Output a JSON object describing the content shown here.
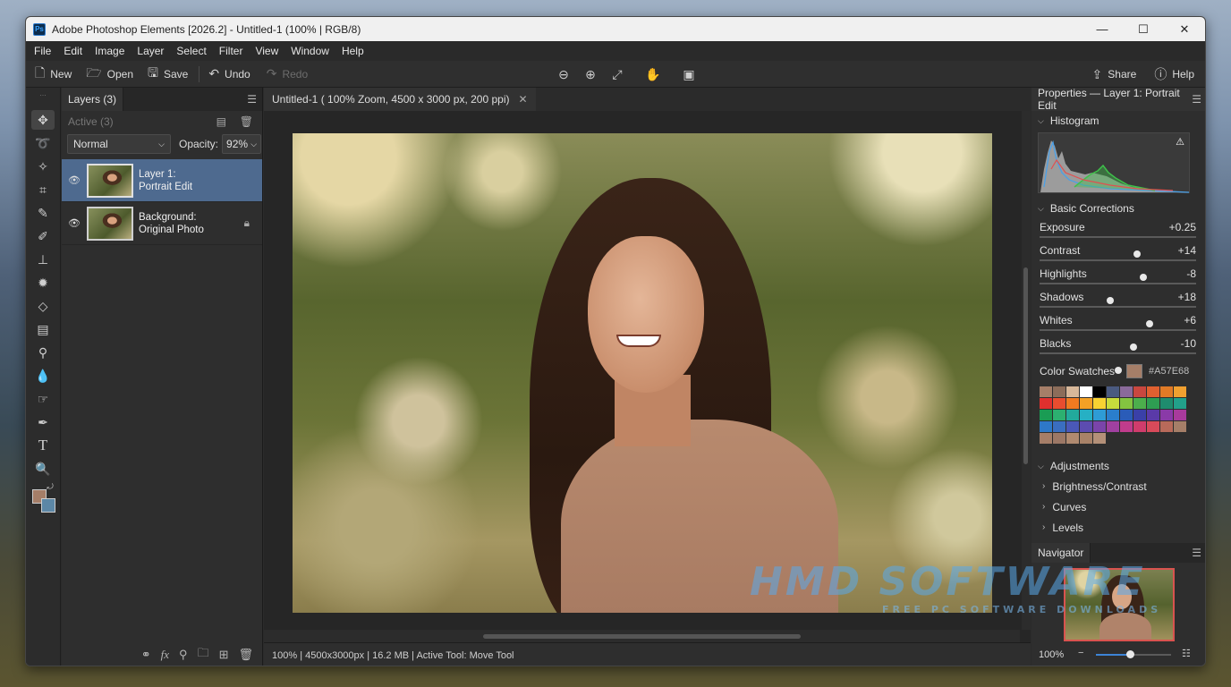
{
  "window": {
    "title": "Adobe Photoshop Elements [2026.2] - Untitled-1 (100% | RGB/8)",
    "app_icon": "Ps"
  },
  "menu": [
    "File",
    "Edit",
    "Image",
    "Layer",
    "Select",
    "Filter",
    "View",
    "Window",
    "Help"
  ],
  "toolbar": {
    "new": "New",
    "open": "Open",
    "save": "Save",
    "undo": "Undo",
    "redo": "Redo",
    "share": "Share",
    "help": "Help"
  },
  "layers": {
    "tab": "Layers (3)",
    "active_label": "Active (3)",
    "blend_mode": "Normal",
    "opacity_label": "Opacity:",
    "opacity_value": "92%",
    "items": [
      {
        "line1": "Layer 1:",
        "line2": "Portrait Edit"
      },
      {
        "line1": "Background:",
        "line2": "Original Photo"
      }
    ]
  },
  "document": {
    "tab": "Untitled-1 ( 100% Zoom, 4500 x 3000 px, 200 ppi)",
    "status": "100% | 4500x3000px | 16.2 MB | Active Tool: Move Tool"
  },
  "properties": {
    "tab": "Properties — Layer 1: Portrait Edit",
    "histogram_label": "Histogram",
    "basic_label": "Basic Corrections",
    "sliders": [
      {
        "label": "Exposure",
        "value": "+0.25",
        "level": 0.62
      },
      {
        "label": "Contrast",
        "value": "+14",
        "level": 0.66
      },
      {
        "label": "Highlights",
        "value": "-8",
        "level": 0.45
      },
      {
        "label": "Shadows",
        "value": "+18",
        "level": 0.7
      },
      {
        "label": "Whites",
        "value": "+6",
        "level": 0.6
      },
      {
        "label": "Blacks",
        "value": "-10",
        "level": 0.5
      }
    ],
    "swatches_label": "Color Swatches",
    "current_swatch": "#A57E68",
    "swatch_colors": [
      "#a57e68",
      "#8c6d5a",
      "#d8b89a",
      "#ffffff",
      "#000000",
      "#4a5a80",
      "#8a6a9a",
      "#c9473f",
      "#e06030",
      "#e07a26",
      "#f0a030",
      "#e0302e",
      "#e84d2f",
      "#f07a20",
      "#f4a125",
      "#f8d232",
      "#c8dc3c",
      "#84c440",
      "#4cae4c",
      "#2e9e52",
      "#1e8c6e",
      "#22a08a",
      "#1a9c54",
      "#2cb070",
      "#22aa9c",
      "#26b0c4",
      "#2e9cd6",
      "#2a7ecc",
      "#2a5cb8",
      "#3a40a8",
      "#5a3aa8",
      "#8a3aa8",
      "#a83a9c",
      "#2e78c8",
      "#3a6ec0",
      "#4a58b8",
      "#5c4cb0",
      "#7a44aa",
      "#a040a0",
      "#c03c8c",
      "#d03c6c",
      "#d84a5a",
      "#b86a5a",
      "#a57e68",
      "#a57e68",
      "#9c7866",
      "#b08a70",
      "#a88268",
      "#b49078"
    ],
    "adjustments_label": "Adjustments",
    "adjustments": [
      "Brightness/Contrast",
      "Curves",
      "Levels"
    ]
  },
  "navigator": {
    "tab": "Navigator",
    "zoom": "100%",
    "zoom_level": 0.45
  },
  "watermark": {
    "line1": "HMD SOFTWARE",
    "line2": "FREE PC SOFTWARE DOWNLOADS"
  },
  "colors": {
    "foreground": "#A57E68",
    "background": "#5C87A6",
    "selection": "#4E6A8F"
  },
  "tools": [
    "move-icon",
    "lasso-icon",
    "magic-wand-icon",
    "crop-icon",
    "eyedropper-icon",
    "brush-icon",
    "stamp-icon",
    "healing-icon",
    "eraser-icon",
    "gradient-icon",
    "dodge-icon",
    "blur-icon",
    "smudge-icon",
    "pen-icon",
    "type-icon",
    "zoom-icon"
  ]
}
